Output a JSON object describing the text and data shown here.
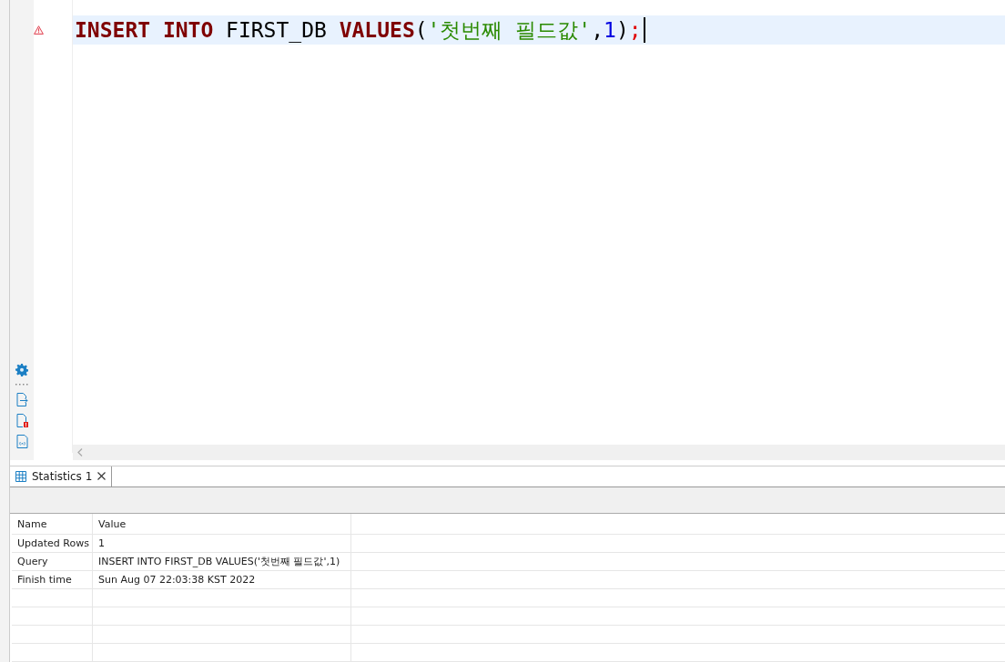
{
  "editor": {
    "lines": [
      {
        "has_error": true,
        "current": true,
        "tokens": [
          {
            "kind": "keyword",
            "text": "INSERT"
          },
          {
            "kind": "keyword",
            "text": "INTO"
          },
          {
            "kind": "ident",
            "text": "FIRST_DB"
          },
          {
            "kind": "keyword",
            "text": "VALUES"
          },
          {
            "kind": "punct",
            "text": "("
          },
          {
            "kind": "string",
            "text": "'첫번째 필드값'"
          },
          {
            "kind": "punct",
            "text": ","
          },
          {
            "kind": "number",
            "text": "1"
          },
          {
            "kind": "punct",
            "text": ")"
          },
          {
            "kind": "terminator",
            "text": ";"
          }
        ]
      }
    ]
  },
  "result_tabs": [
    {
      "label": "Statistics 1",
      "selected": true
    }
  ],
  "table": {
    "columns": [
      "Name",
      "Value"
    ],
    "rows": [
      [
        "Updated Rows",
        "1"
      ],
      [
        "Query",
        "INSERT INTO FIRST_DB VALUES('첫번째 필드값',1)"
      ],
      [
        "Finish time",
        "Sun Aug 07 22:03:38 KST 2022"
      ]
    ]
  }
}
